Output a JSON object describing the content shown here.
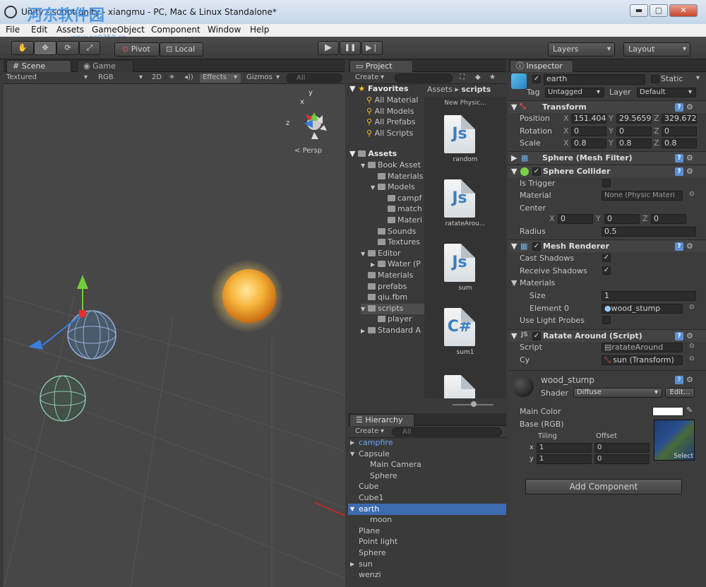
{
  "window": {
    "title": "Unity - script.unity - xiangmu - PC, Mac & Linux Standalone*",
    "watermark_text": "河东软件园",
    "watermark_url": "www.pc0359.cn",
    "minimize": "▬",
    "maximize": "▢",
    "close": "✕"
  },
  "menu": [
    "File",
    "Edit",
    "Assets",
    "GameObject",
    "Component",
    "Window",
    "Help"
  ],
  "toolbar": {
    "pivot": "Pivot",
    "local": "Local",
    "play": "▶",
    "pause": "❚❚",
    "step": "▶❘",
    "layers": "Layers",
    "layout": "Layout"
  },
  "scene": {
    "tab_scene": "Scene",
    "tab_game": "Game",
    "render_mode": "Textured",
    "color_mode": "RGB",
    "mode_2d": "2D",
    "effects": "Effects",
    "gizmos": "Gizmos",
    "search_placeholder": "All",
    "gizmo_x": "x",
    "gizmo_y": "y",
    "gizmo_z": "z",
    "persp": "Persp"
  },
  "project": {
    "tab": "Project",
    "create": "Create",
    "breadcrumb_assets": "Assets",
    "breadcrumb_sep": "▸",
    "breadcrumb_scripts": "scripts",
    "favorites_label": "Favorites",
    "favorites": [
      "All Material",
      "All Models",
      "All Prefabs",
      "All Scripts"
    ],
    "assets_label": "Assets",
    "tree": [
      {
        "label": "Book Asset",
        "indent": 1,
        "arrow": "▼"
      },
      {
        "label": "Materials",
        "indent": 2,
        "arrow": ""
      },
      {
        "label": "Models",
        "indent": 2,
        "arrow": "▼"
      },
      {
        "label": "campf",
        "indent": 3,
        "arrow": ""
      },
      {
        "label": "match",
        "indent": 3,
        "arrow": ""
      },
      {
        "label": "Materi",
        "indent": 3,
        "arrow": ""
      },
      {
        "label": "Sounds",
        "indent": 2,
        "arrow": ""
      },
      {
        "label": "Textures",
        "indent": 2,
        "arrow": ""
      },
      {
        "label": "Editor",
        "indent": 1,
        "arrow": "▼"
      },
      {
        "label": "Water (P",
        "indent": 2,
        "arrow": "▶"
      },
      {
        "label": "Materials",
        "indent": 1,
        "arrow": ""
      },
      {
        "label": "prefabs",
        "indent": 1,
        "arrow": ""
      },
      {
        "label": "qiu.fbm",
        "indent": 1,
        "arrow": ""
      },
      {
        "label": "scripts",
        "indent": 1,
        "arrow": "▼"
      },
      {
        "label": "player",
        "indent": 2,
        "arrow": ""
      },
      {
        "label": "Standard A",
        "indent": 1,
        "arrow": "▶"
      }
    ],
    "files_header": "New Physic...",
    "files": [
      {
        "name": "random",
        "glyph": "Js"
      },
      {
        "name": "ratateArou...",
        "glyph": "Js"
      },
      {
        "name": "sum",
        "glyph": "Js"
      },
      {
        "name": "sum1",
        "glyph": "C#"
      }
    ]
  },
  "hierarchy": {
    "tab": "Hierarchy",
    "create": "Create",
    "search_placeholder": "All",
    "items": [
      {
        "label": "campfire",
        "indent": 0,
        "arrow": "▶",
        "style": "prefab"
      },
      {
        "label": "Capsule",
        "indent": 0,
        "arrow": "▼",
        "style": ""
      },
      {
        "label": "Main Camera",
        "indent": 1,
        "arrow": "",
        "style": ""
      },
      {
        "label": "Sphere",
        "indent": 1,
        "arrow": "",
        "style": ""
      },
      {
        "label": "Cube",
        "indent": 0,
        "arrow": "",
        "style": ""
      },
      {
        "label": "Cube1",
        "indent": 0,
        "arrow": "",
        "style": ""
      },
      {
        "label": "earth",
        "indent": 0,
        "arrow": "▼",
        "style": "selected"
      },
      {
        "label": "moon",
        "indent": 1,
        "arrow": "",
        "style": ""
      },
      {
        "label": "Plane",
        "indent": 0,
        "arrow": "",
        "style": ""
      },
      {
        "label": "Point light",
        "indent": 0,
        "arrow": "",
        "style": ""
      },
      {
        "label": "Sphere",
        "indent": 0,
        "arrow": "",
        "style": ""
      },
      {
        "label": "sun",
        "indent": 0,
        "arrow": "▶",
        "style": ""
      },
      {
        "label": "wenzi",
        "indent": 0,
        "arrow": "",
        "style": ""
      }
    ]
  },
  "inspector": {
    "tab": "Inspector",
    "object_name": "earth",
    "static": "Static",
    "tag_label": "Tag",
    "tag_value": "Untagged",
    "layer_label": "Layer",
    "layer_value": "Default",
    "transform": {
      "title": "Transform",
      "position_label": "Position",
      "position": [
        "151.404",
        "29.5659",
        "329.672"
      ],
      "rotation_label": "Rotation",
      "rotation": [
        "0",
        "0",
        "0"
      ],
      "scale_label": "Scale",
      "scale": [
        "0.8",
        "0.8",
        "0.8"
      ],
      "axis": [
        "X",
        "Y",
        "Z"
      ]
    },
    "mesh_filter": "Sphere (Mesh Filter)",
    "sphere_collider": {
      "title": "Sphere Collider",
      "is_trigger": "Is Trigger",
      "material_label": "Material",
      "material_value": "None (Physic Materi",
      "center_label": "Center",
      "center": [
        "0",
        "0",
        "0"
      ],
      "radius_label": "Radius",
      "radius": "0.5"
    },
    "mesh_renderer": {
      "title": "Mesh Renderer",
      "cast_shadows": "Cast Shadows",
      "receive_shadows": "Receive Shadows",
      "materials": "Materials",
      "size_label": "Size",
      "size": "1",
      "element_label": "Element 0",
      "element_value": "wood_stump",
      "light_probes": "Use Light Probes"
    },
    "rotate_script": {
      "title": "Ratate Around (Script)",
      "script_label": "Script",
      "script_value": "ratateAround",
      "cy_label": "Cy",
      "cy_value": "sun (Transform)"
    },
    "material": {
      "name": "wood_stump",
      "shader_label": "Shader",
      "shader_value": "Diffuse",
      "edit": "Edit...",
      "main_color": "Main Color",
      "base": "Base (RGB)",
      "tiling": "Tiling",
      "offset": "Offset",
      "x_label": "x",
      "y_label": "y",
      "tiling_x": "1",
      "tiling_y": "1",
      "offset_x": "0",
      "offset_y": "0",
      "select": "Select"
    },
    "add_component": "Add Component"
  }
}
